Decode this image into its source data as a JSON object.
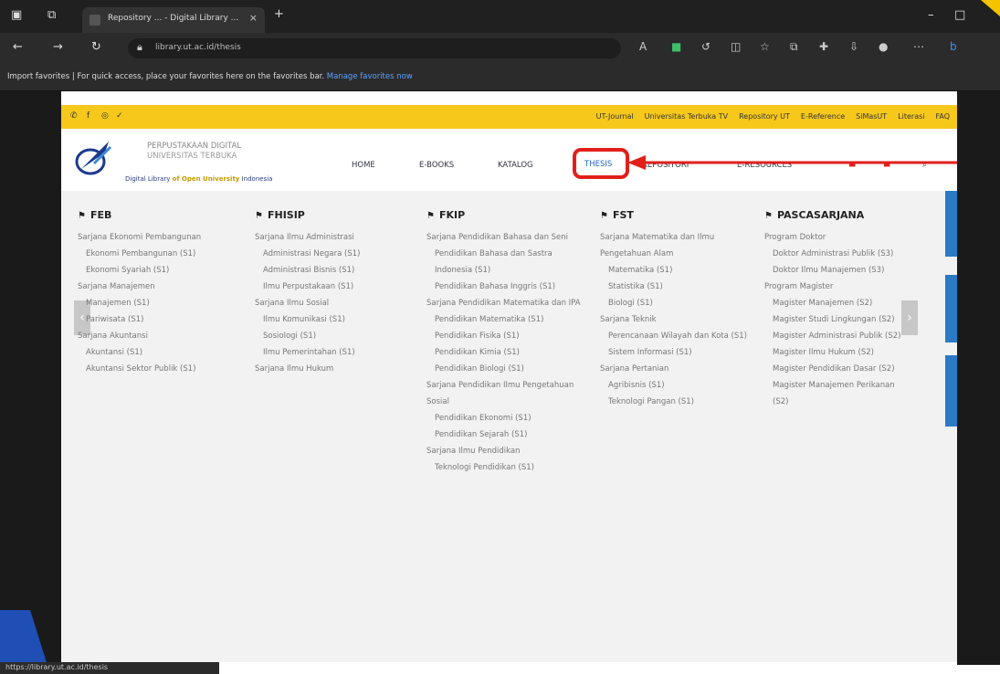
{
  "browser": {
    "tab_title": "Repository ... - Digital Library ...",
    "tab_close": "×",
    "new_tab": "+",
    "url": "library.ut.ac.id/thesis",
    "favorites_bar_text": "Import favorites | For quick access, place your favorites here on the favorites bar.",
    "favorites_link": "Manage favorites now",
    "status_url": "https://library.ut.ac.id/thesis"
  },
  "site": {
    "brand_line1": "PERPUSTAKAAN DIGITAL",
    "brand_line2": "UNIVERSITAS TERBUKA",
    "brand_tagline_a": "Digital Library",
    "brand_tagline_b": "of Open University",
    "brand_tagline_c": "Indonesia",
    "top_links": [
      "UT-Journal",
      "Universitas Terbuka TV",
      "Repository UT",
      "E-Reference",
      "SiMasUT",
      "Literasi",
      "FAQ"
    ],
    "menu": [
      "HOME",
      "E-BOOKS",
      "KATALOG",
      "THESIS",
      "REPOSITORI",
      "E-RESOURCES"
    ]
  },
  "columns": [
    {
      "heading": "FEB",
      "items": [
        {
          "text": "Sarjana Ekonomi Pembangunan",
          "level": 1
        },
        {
          "text": "Ekonomi Pembangunan (S1)",
          "level": 2
        },
        {
          "text": "Ekonomi Syariah (S1)",
          "level": 2
        },
        {
          "text": "Sarjana Manajemen",
          "level": 1
        },
        {
          "text": "Manajemen (S1)",
          "level": 2
        },
        {
          "text": "Pariwisata (S1)",
          "level": 2
        },
        {
          "text": "Sarjana Akuntansi",
          "level": 1
        },
        {
          "text": "Akuntansi (S1)",
          "level": 2
        },
        {
          "text": "Akuntansi Sektor Publik (S1)",
          "level": 2
        }
      ]
    },
    {
      "heading": "FHISIP",
      "items": [
        {
          "text": "Sarjana Ilmu Administrasi",
          "level": 1
        },
        {
          "text": "Administrasi Negara (S1)",
          "level": 2
        },
        {
          "text": "Administrasi Bisnis (S1)",
          "level": 2
        },
        {
          "text": "Ilmu Perpustakaan (S1)",
          "level": 2
        },
        {
          "text": "Sarjana Ilmu Sosial",
          "level": 1
        },
        {
          "text": "Ilmu Komunikasi (S1)",
          "level": 2
        },
        {
          "text": "Sosiologi (S1)",
          "level": 2
        },
        {
          "text": "Ilmu Pemerintahan (S1)",
          "level": 2
        },
        {
          "text": "Sarjana Ilmu Hukum",
          "level": 1
        }
      ]
    },
    {
      "heading": "FKIP",
      "items": [
        {
          "text": "Sarjana Pendidikan Bahasa dan Seni",
          "level": 1
        },
        {
          "text": "Pendidikan Bahasa dan Sastra Indonesia (S1)",
          "level": 2
        },
        {
          "text": "Pendidikan Bahasa Inggris (S1)",
          "level": 2
        },
        {
          "text": "Sarjana Pendidikan Matematika dan IPA",
          "level": 1
        },
        {
          "text": "Pendidikan Matematika (S1)",
          "level": 2
        },
        {
          "text": "Pendidikan Fisika (S1)",
          "level": 2
        },
        {
          "text": "Pendidikan Kimia (S1)",
          "level": 2
        },
        {
          "text": "Pendidikan Biologi (S1)",
          "level": 2
        },
        {
          "text": "Sarjana Pendidikan Ilmu Pengetahuan Sosial",
          "level": 1
        },
        {
          "text": "Pendidikan Ekonomi (S1)",
          "level": 2
        },
        {
          "text": "Pendidikan Sejarah (S1)",
          "level": 2
        },
        {
          "text": "Sarjana Ilmu Pendidikan",
          "level": 1
        },
        {
          "text": "Teknologi Pendidikan (S1)",
          "level": 2
        }
      ]
    },
    {
      "heading": "FST",
      "items": [
        {
          "text": "Sarjana Matematika dan Ilmu Pengetahuan Alam",
          "level": 1
        },
        {
          "text": "Matematika (S1)",
          "level": 2
        },
        {
          "text": "Statistika (S1)",
          "level": 2
        },
        {
          "text": "Biologi (S1)",
          "level": 2
        },
        {
          "text": "Sarjana Teknik",
          "level": 1
        },
        {
          "text": "Perencanaan Wilayah dan Kota (S1)",
          "level": 2
        },
        {
          "text": "Sistem Informasi (S1)",
          "level": 2
        },
        {
          "text": "Sarjana Pertanian",
          "level": 1
        },
        {
          "text": "Agribisnis (S1)",
          "level": 2
        },
        {
          "text": "Teknologi Pangan (S1)",
          "level": 2
        }
      ]
    },
    {
      "heading": "PASCASARJANA",
      "items": [
        {
          "text": "Program Doktor",
          "level": 1
        },
        {
          "text": "Doktor Administrasi Publik (S3)",
          "level": 2
        },
        {
          "text": "Doktor Ilmu Manajemen (S3)",
          "level": 2
        },
        {
          "text": "Program Magister",
          "level": 1
        },
        {
          "text": "Magister Manajemen (S2)",
          "level": 2
        },
        {
          "text": "Magister Studi Lingkungan (S2)",
          "level": 2
        },
        {
          "text": "Magister Administrasi Publik (S2)",
          "level": 2
        },
        {
          "text": "Magister Ilmu Hukum (S2)",
          "level": 2
        },
        {
          "text": "Magister Pendidikan Dasar (S2)",
          "level": 2
        },
        {
          "text": "Magister Manajemen Perikanan (S2)",
          "level": 2
        }
      ]
    }
  ],
  "colors": {
    "accent_yellow": "#f6c81b",
    "highlight_red": "#e1201b",
    "link_blue": "#2563c9"
  },
  "icons": [
    "back-icon",
    "forward-icon",
    "refresh-icon",
    "lock-icon",
    "flag-icon",
    "search-icon",
    "translate-icon"
  ]
}
